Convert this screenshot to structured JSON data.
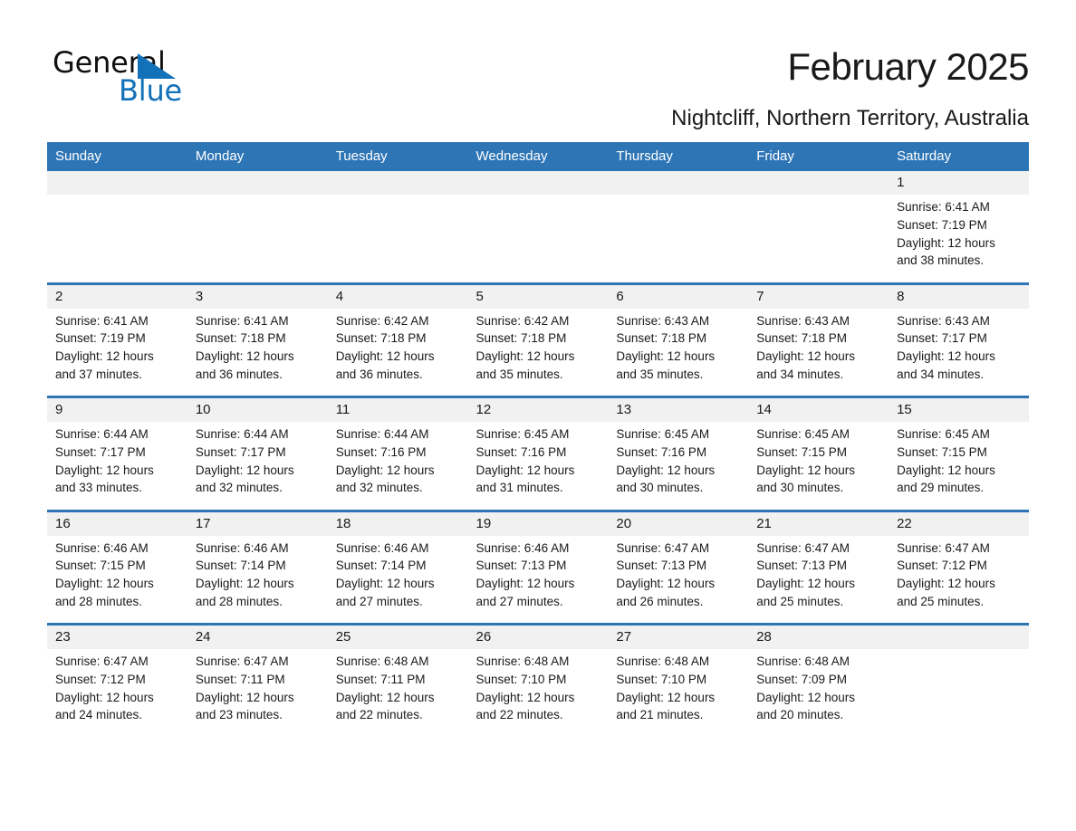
{
  "brand": {
    "word_one": "General",
    "word_two": "Blue",
    "accent_color": "#1271b8"
  },
  "header": {
    "title": "February 2025",
    "subtitle": "Nightcliff, Northern Territory, Australia",
    "header_bg": "#2e75b6",
    "daynum_bg": "#f1f1f1"
  },
  "weekdays": [
    "Sunday",
    "Monday",
    "Tuesday",
    "Wednesday",
    "Thursday",
    "Friday",
    "Saturday"
  ],
  "weeks": [
    [
      {
        "day": "",
        "sunrise": "",
        "sunset": "",
        "daylight": "",
        "daylight2": ""
      },
      {
        "day": "",
        "sunrise": "",
        "sunset": "",
        "daylight": "",
        "daylight2": ""
      },
      {
        "day": "",
        "sunrise": "",
        "sunset": "",
        "daylight": "",
        "daylight2": ""
      },
      {
        "day": "",
        "sunrise": "",
        "sunset": "",
        "daylight": "",
        "daylight2": ""
      },
      {
        "day": "",
        "sunrise": "",
        "sunset": "",
        "daylight": "",
        "daylight2": ""
      },
      {
        "day": "",
        "sunrise": "",
        "sunset": "",
        "daylight": "",
        "daylight2": ""
      },
      {
        "day": "1",
        "sunrise": "Sunrise: 6:41 AM",
        "sunset": "Sunset: 7:19 PM",
        "daylight": "Daylight: 12 hours",
        "daylight2": "and 38 minutes."
      }
    ],
    [
      {
        "day": "2",
        "sunrise": "Sunrise: 6:41 AM",
        "sunset": "Sunset: 7:19 PM",
        "daylight": "Daylight: 12 hours",
        "daylight2": "and 37 minutes."
      },
      {
        "day": "3",
        "sunrise": "Sunrise: 6:41 AM",
        "sunset": "Sunset: 7:18 PM",
        "daylight": "Daylight: 12 hours",
        "daylight2": "and 36 minutes."
      },
      {
        "day": "4",
        "sunrise": "Sunrise: 6:42 AM",
        "sunset": "Sunset: 7:18 PM",
        "daylight": "Daylight: 12 hours",
        "daylight2": "and 36 minutes."
      },
      {
        "day": "5",
        "sunrise": "Sunrise: 6:42 AM",
        "sunset": "Sunset: 7:18 PM",
        "daylight": "Daylight: 12 hours",
        "daylight2": "and 35 minutes."
      },
      {
        "day": "6",
        "sunrise": "Sunrise: 6:43 AM",
        "sunset": "Sunset: 7:18 PM",
        "daylight": "Daylight: 12 hours",
        "daylight2": "and 35 minutes."
      },
      {
        "day": "7",
        "sunrise": "Sunrise: 6:43 AM",
        "sunset": "Sunset: 7:18 PM",
        "daylight": "Daylight: 12 hours",
        "daylight2": "and 34 minutes."
      },
      {
        "day": "8",
        "sunrise": "Sunrise: 6:43 AM",
        "sunset": "Sunset: 7:17 PM",
        "daylight": "Daylight: 12 hours",
        "daylight2": "and 34 minutes."
      }
    ],
    [
      {
        "day": "9",
        "sunrise": "Sunrise: 6:44 AM",
        "sunset": "Sunset: 7:17 PM",
        "daylight": "Daylight: 12 hours",
        "daylight2": "and 33 minutes."
      },
      {
        "day": "10",
        "sunrise": "Sunrise: 6:44 AM",
        "sunset": "Sunset: 7:17 PM",
        "daylight": "Daylight: 12 hours",
        "daylight2": "and 32 minutes."
      },
      {
        "day": "11",
        "sunrise": "Sunrise: 6:44 AM",
        "sunset": "Sunset: 7:16 PM",
        "daylight": "Daylight: 12 hours",
        "daylight2": "and 32 minutes."
      },
      {
        "day": "12",
        "sunrise": "Sunrise: 6:45 AM",
        "sunset": "Sunset: 7:16 PM",
        "daylight": "Daylight: 12 hours",
        "daylight2": "and 31 minutes."
      },
      {
        "day": "13",
        "sunrise": "Sunrise: 6:45 AM",
        "sunset": "Sunset: 7:16 PM",
        "daylight": "Daylight: 12 hours",
        "daylight2": "and 30 minutes."
      },
      {
        "day": "14",
        "sunrise": "Sunrise: 6:45 AM",
        "sunset": "Sunset: 7:15 PM",
        "daylight": "Daylight: 12 hours",
        "daylight2": "and 30 minutes."
      },
      {
        "day": "15",
        "sunrise": "Sunrise: 6:45 AM",
        "sunset": "Sunset: 7:15 PM",
        "daylight": "Daylight: 12 hours",
        "daylight2": "and 29 minutes."
      }
    ],
    [
      {
        "day": "16",
        "sunrise": "Sunrise: 6:46 AM",
        "sunset": "Sunset: 7:15 PM",
        "daylight": "Daylight: 12 hours",
        "daylight2": "and 28 minutes."
      },
      {
        "day": "17",
        "sunrise": "Sunrise: 6:46 AM",
        "sunset": "Sunset: 7:14 PM",
        "daylight": "Daylight: 12 hours",
        "daylight2": "and 28 minutes."
      },
      {
        "day": "18",
        "sunrise": "Sunrise: 6:46 AM",
        "sunset": "Sunset: 7:14 PM",
        "daylight": "Daylight: 12 hours",
        "daylight2": "and 27 minutes."
      },
      {
        "day": "19",
        "sunrise": "Sunrise: 6:46 AM",
        "sunset": "Sunset: 7:13 PM",
        "daylight": "Daylight: 12 hours",
        "daylight2": "and 27 minutes."
      },
      {
        "day": "20",
        "sunrise": "Sunrise: 6:47 AM",
        "sunset": "Sunset: 7:13 PM",
        "daylight": "Daylight: 12 hours",
        "daylight2": "and 26 minutes."
      },
      {
        "day": "21",
        "sunrise": "Sunrise: 6:47 AM",
        "sunset": "Sunset: 7:13 PM",
        "daylight": "Daylight: 12 hours",
        "daylight2": "and 25 minutes."
      },
      {
        "day": "22",
        "sunrise": "Sunrise: 6:47 AM",
        "sunset": "Sunset: 7:12 PM",
        "daylight": "Daylight: 12 hours",
        "daylight2": "and 25 minutes."
      }
    ],
    [
      {
        "day": "23",
        "sunrise": "Sunrise: 6:47 AM",
        "sunset": "Sunset: 7:12 PM",
        "daylight": "Daylight: 12 hours",
        "daylight2": "and 24 minutes."
      },
      {
        "day": "24",
        "sunrise": "Sunrise: 6:47 AM",
        "sunset": "Sunset: 7:11 PM",
        "daylight": "Daylight: 12 hours",
        "daylight2": "and 23 minutes."
      },
      {
        "day": "25",
        "sunrise": "Sunrise: 6:48 AM",
        "sunset": "Sunset: 7:11 PM",
        "daylight": "Daylight: 12 hours",
        "daylight2": "and 22 minutes."
      },
      {
        "day": "26",
        "sunrise": "Sunrise: 6:48 AM",
        "sunset": "Sunset: 7:10 PM",
        "daylight": "Daylight: 12 hours",
        "daylight2": "and 22 minutes."
      },
      {
        "day": "27",
        "sunrise": "Sunrise: 6:48 AM",
        "sunset": "Sunset: 7:10 PM",
        "daylight": "Daylight: 12 hours",
        "daylight2": "and 21 minutes."
      },
      {
        "day": "28",
        "sunrise": "Sunrise: 6:48 AM",
        "sunset": "Sunset: 7:09 PM",
        "daylight": "Daylight: 12 hours",
        "daylight2": "and 20 minutes."
      },
      {
        "day": "",
        "sunrise": "",
        "sunset": "",
        "daylight": "",
        "daylight2": ""
      }
    ]
  ]
}
